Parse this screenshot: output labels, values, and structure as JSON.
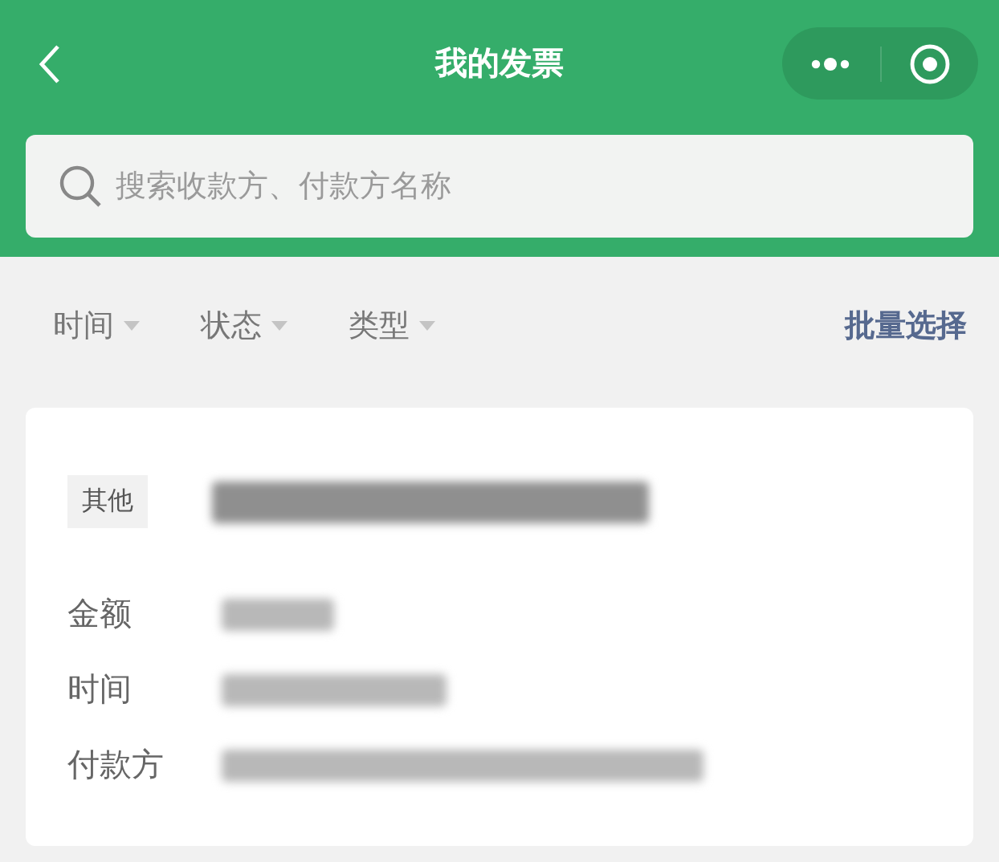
{
  "nav_bar": {
    "title": "我的发票"
  },
  "search": {
    "placeholder": "搜索收款方、付款方名称"
  },
  "filters": [
    {
      "label": "时间"
    },
    {
      "label": "状态"
    },
    {
      "label": "类型"
    }
  ],
  "batch_select": "批量选择",
  "invoices": [
    {
      "tag": "其他",
      "fields": [
        {
          "label": "金额"
        },
        {
          "label": "时间"
        },
        {
          "label": "付款方"
        }
      ]
    }
  ]
}
